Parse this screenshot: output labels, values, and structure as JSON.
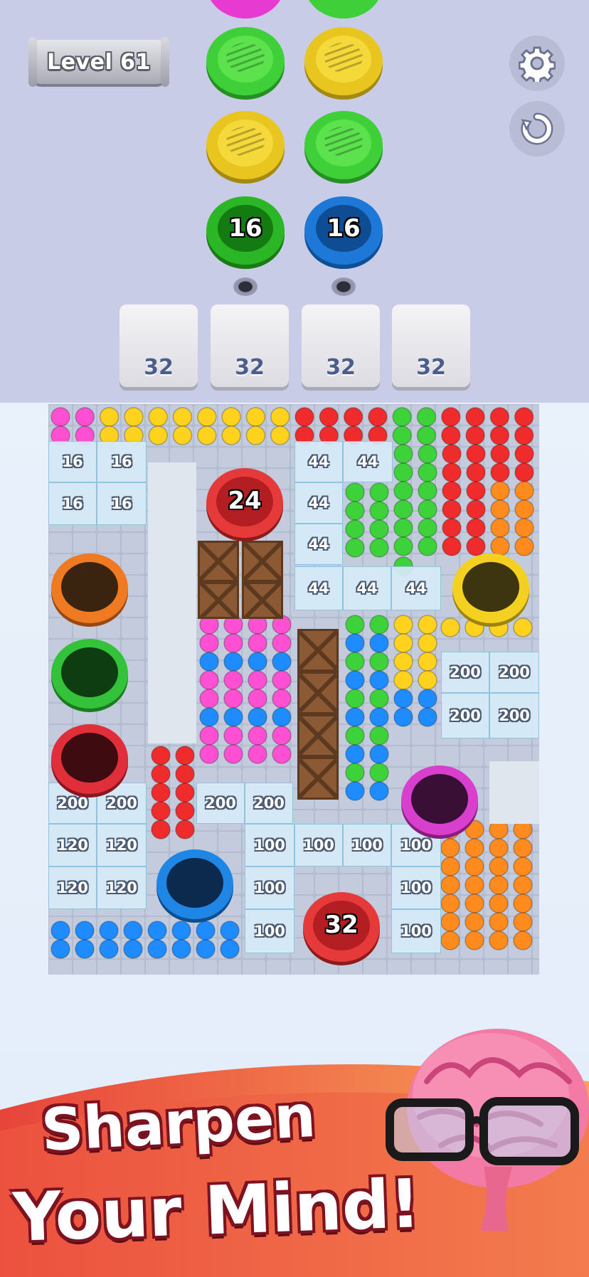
{
  "header": {
    "level_label": "Level 61",
    "settings_icon": "gear-icon",
    "restart_icon": "restart-icon"
  },
  "queue_spools": {
    "left_column": [
      {
        "color": "#4ed63b",
        "label": ""
      },
      {
        "color": "#f2d12a",
        "label": ""
      },
      {
        "color": "#2fbf27",
        "label": "16"
      }
    ],
    "right_column": [
      {
        "color": "#f2d12a",
        "label": ""
      },
      {
        "color": "#4ed63b",
        "label": ""
      },
      {
        "color": "#1f7fe0",
        "label": "16"
      }
    ]
  },
  "slots": [
    {
      "label": "32"
    },
    {
      "label": "32"
    },
    {
      "label": "32"
    },
    {
      "label": "32"
    }
  ],
  "board": {
    "ice_blocks": [
      "16",
      "16",
      "16",
      "16",
      "44",
      "44",
      "44",
      "44",
      "44",
      "44",
      "44",
      "200",
      "200",
      "200",
      "200",
      "200",
      "200",
      "200",
      "200",
      "120",
      "120",
      "120",
      "120",
      "100",
      "100",
      "100",
      "100",
      "100",
      "100",
      "100",
      "100"
    ],
    "holes": [
      {
        "color": "#e63a3a",
        "label": "24"
      },
      {
        "color": "#f07a22",
        "label": ""
      },
      {
        "color": "#f4d121",
        "label": ""
      },
      {
        "color": "#33c23a",
        "label": ""
      },
      {
        "color": "#e02e3a",
        "label": ""
      },
      {
        "color": "#d83fcc",
        "label": ""
      },
      {
        "color": "#1f86e6",
        "label": ""
      },
      {
        "color": "#e63a3a",
        "label": "32"
      }
    ],
    "ball_colors": {
      "pink": "#ff4fd2",
      "yellow": "#ffd21e",
      "red": "#ef2b2b",
      "green": "#3ed23a",
      "orange": "#ff8a1e",
      "blue": "#1e8cff"
    }
  },
  "banner": {
    "line1": "Sharpen",
    "line2": "Your Mind!",
    "mascot_icon": "brain-with-glasses-icon"
  }
}
